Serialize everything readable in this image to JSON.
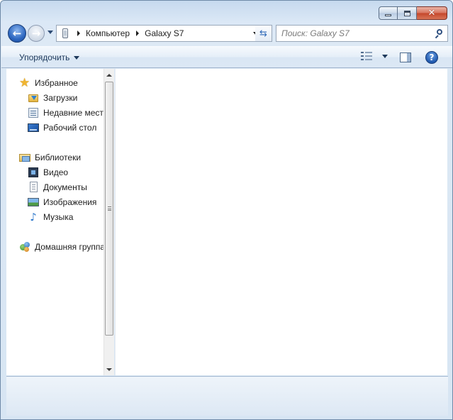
{
  "window": {
    "caption_buttons": {
      "minimize": "minimize",
      "maximize": "maximize",
      "close": "close"
    }
  },
  "navigation": {
    "back_icon": "back-arrow-icon",
    "forward_icon": "forward-arrow-icon",
    "address": {
      "device_icon": "phone-device-icon",
      "breadcrumbs": [
        "Компьютер",
        "Galaxy S7"
      ]
    },
    "refresh_icon": "refresh-icon",
    "search": {
      "placeholder": "Поиск: Galaxy S7",
      "value": ""
    }
  },
  "command_bar": {
    "organize_label": "Упорядочить",
    "views_icon": "views-icon",
    "preview_pane_icon": "preview-pane-icon",
    "help_glyph": "?"
  },
  "nav_pane": {
    "favorites": {
      "label": "Избранное",
      "items": [
        {
          "label": "Загрузки",
          "icon": "downloads-folder-icon"
        },
        {
          "label": "Недавние места",
          "icon": "recent-places-icon"
        },
        {
          "label": "Рабочий стол",
          "icon": "desktop-icon"
        }
      ]
    },
    "libraries": {
      "label": "Библиотеки",
      "items": [
        {
          "label": "Видео",
          "icon": "video-library-icon"
        },
        {
          "label": "Документы",
          "icon": "documents-library-icon"
        },
        {
          "label": "Изображения",
          "icon": "pictures-library-icon"
        },
        {
          "label": "Музыка",
          "icon": "music-library-icon"
        }
      ]
    },
    "homegroup": {
      "label": "Домашняя группа",
      "icon": "homegroup-icon"
    }
  },
  "colors": {
    "frame": "#dbe8f6",
    "accent": "#2d67c0",
    "close_button": "#c4452a"
  }
}
